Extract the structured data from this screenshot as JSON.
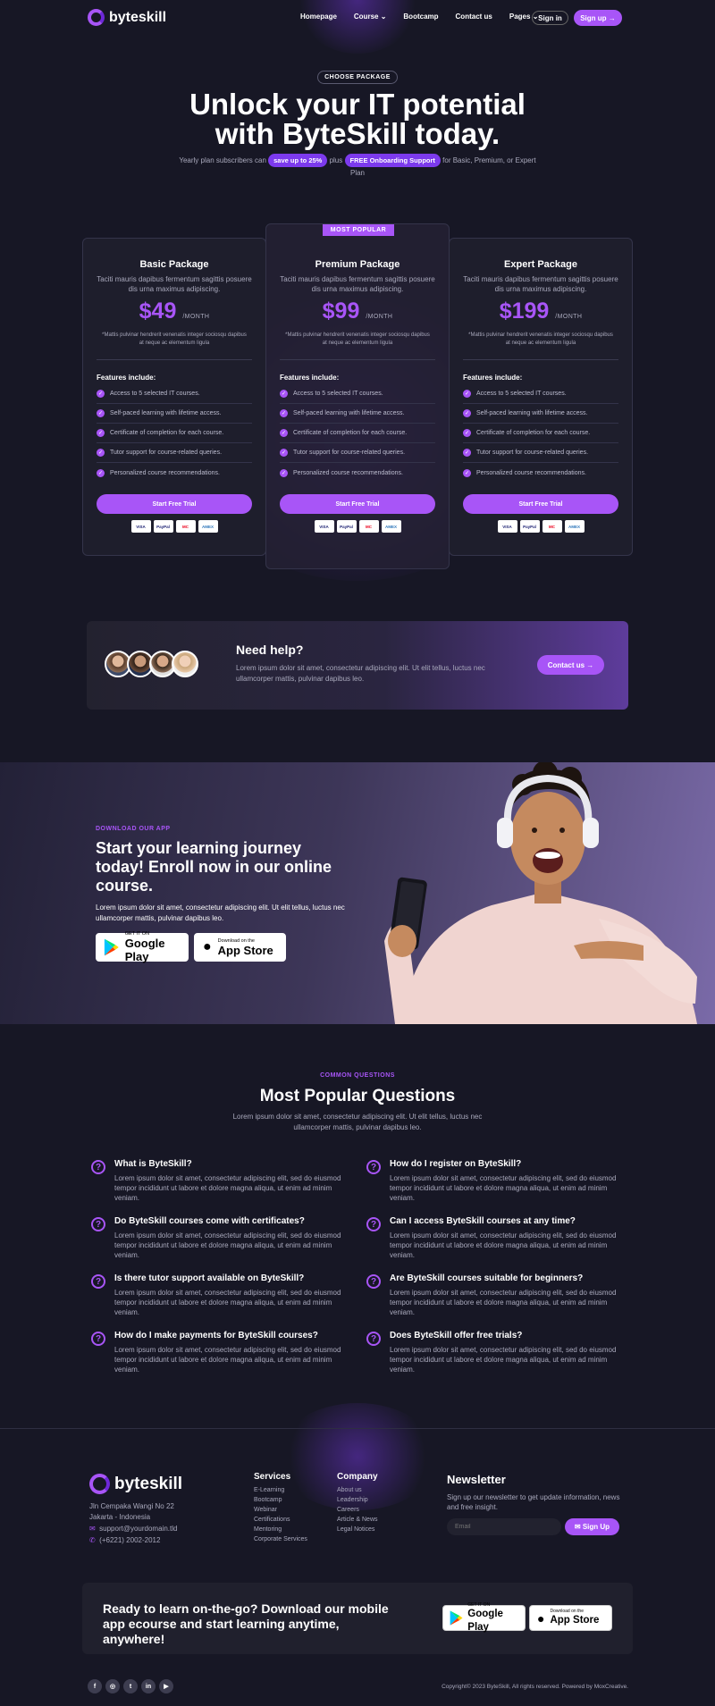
{
  "nav": {
    "brand": "byteskill",
    "links": [
      "Homepage",
      "Course",
      "Bootcamp",
      "Contact us",
      "Pages"
    ],
    "signin": "Sign in",
    "signup": "Sign up →"
  },
  "hero": {
    "tag": "CHOOSE PACKAGE",
    "title_line1": "Unlock your IT potential",
    "title_line2": "with ByteSkill today.",
    "sub_a": "Yearly plan subscribers can",
    "sub_hl1": "save up to 25%",
    "sub_b": "plus",
    "sub_hl2": "FREE Onboarding Support",
    "sub_c": "for Basic, Premium, or Expert Plan"
  },
  "plans": [
    {
      "name": "Basic Package",
      "desc": "Taciti mauris dapibus fermentum sagittis posuere dis urna maximus adipiscing.",
      "price": "$49",
      "per": "/MONTH",
      "note": "*Mattis pulvinar hendrerit venenatis integer sociosqu dapibus at neque ac elementum ligula",
      "cta": "Start Free Trial"
    },
    {
      "name": "Premium Package",
      "desc": "Taciti mauris dapibus fermentum sagittis posuere dis urna maximus adipiscing.",
      "price": "$99",
      "per": "/MONTH",
      "note": "*Mattis pulvinar hendrerit venenatis integer sociosqu dapibus at neque ac elementum ligula",
      "cta": "Start Free Trial",
      "badge": "MOST POPULAR"
    },
    {
      "name": "Expert Package",
      "desc": "Taciti mauris dapibus fermentum sagittis posuere dis urna maximus adipiscing.",
      "price": "$199",
      "per": "/MONTH",
      "note": "*Mattis pulvinar hendrerit venenatis integer sociosqu dapibus at neque ac elementum ligula",
      "cta": "Start Free Trial"
    }
  ],
  "features_label": "Features include:",
  "features": [
    "Access to 5 selected IT courses.",
    "Self-paced learning with lifetime access.",
    "Certificate of completion for each course.",
    "Tutor support for course-related queries.",
    "Personalized course recommendations."
  ],
  "payments": [
    "VISA",
    "PayPal",
    "MC",
    "AMEX"
  ],
  "help": {
    "title": "Need help?",
    "text": "Lorem ipsum dolor sit amet, consectetur adipiscing elit. Ut elit tellus, luctus nec ullamcorper mattis, pulvinar dapibus leo.",
    "cta": "Contact us →"
  },
  "app": {
    "tag": "DOWNLOAD OUR APP",
    "title": "Start your learning journey today! Enroll now in our online course.",
    "text": "Lorem ipsum dolor sit amet, consectetur adipiscing elit. Ut elit tellus, luctus nec ullamcorper mattis, pulvinar dapibus leo.",
    "gp_small": "GET IT ON",
    "gp_big": "Google Play",
    "as_small": "Download on the",
    "as_big": "App Store"
  },
  "faq": {
    "tag": "COMMON QUESTIONS",
    "title": "Most Popular Questions",
    "sub": "Lorem ipsum dolor sit amet, consectetur adipiscing elit. Ut elit tellus, luctus nec ullamcorper mattis, pulvinar dapibus leo.",
    "answer": "Lorem ipsum dolor sit amet, consectetur adipiscing elit, sed do eiusmod tempor incididunt ut labore et dolore magna aliqua, ut enim ad minim veniam.",
    "items": [
      "What is ByteSkill?",
      "How do I register on ByteSkill?",
      "Do ByteSkill courses come with certificates?",
      "Can I access ByteSkill courses at any time?",
      "Is there tutor support available on ByteSkill?",
      "Are ByteSkill courses suitable for beginners?",
      "How do I make payments for ByteSkill courses?",
      "Does ByteSkill offer free trials?"
    ]
  },
  "footer": {
    "brand": "byteskill",
    "addr1": "Jln Cempaka Wangi No 22",
    "addr2": "Jakarta - Indonesia",
    "email": "support@yourdomain.tld",
    "phone": "(+6221) 2002-2012",
    "services_title": "Services",
    "services": [
      "E-Learning",
      "Bootcamp",
      "Webinar",
      "Certifications",
      "Mentoring",
      "Corporate Services"
    ],
    "company_title": "Company",
    "company": [
      "About us",
      "Leadership",
      "Careers",
      "Article & News",
      "Legal Notices"
    ],
    "news_title": "Newsletter",
    "news_text": "Sign up our newsletter to get update information, news and free insight.",
    "email_ph": "Email",
    "signup": "✉ Sign Up",
    "banner": "Ready to learn on-the-go? Download our mobile app ecourse and start learning anytime, anywhere!",
    "copyright": "Copyright© 2023 ByteSkill, All rights reserved. Powered by MoxCreative.",
    "socials": [
      "f",
      "◎",
      "t",
      "in",
      "▶"
    ]
  },
  "colors": {
    "accent": "#a855f7",
    "bg": "#171725"
  }
}
